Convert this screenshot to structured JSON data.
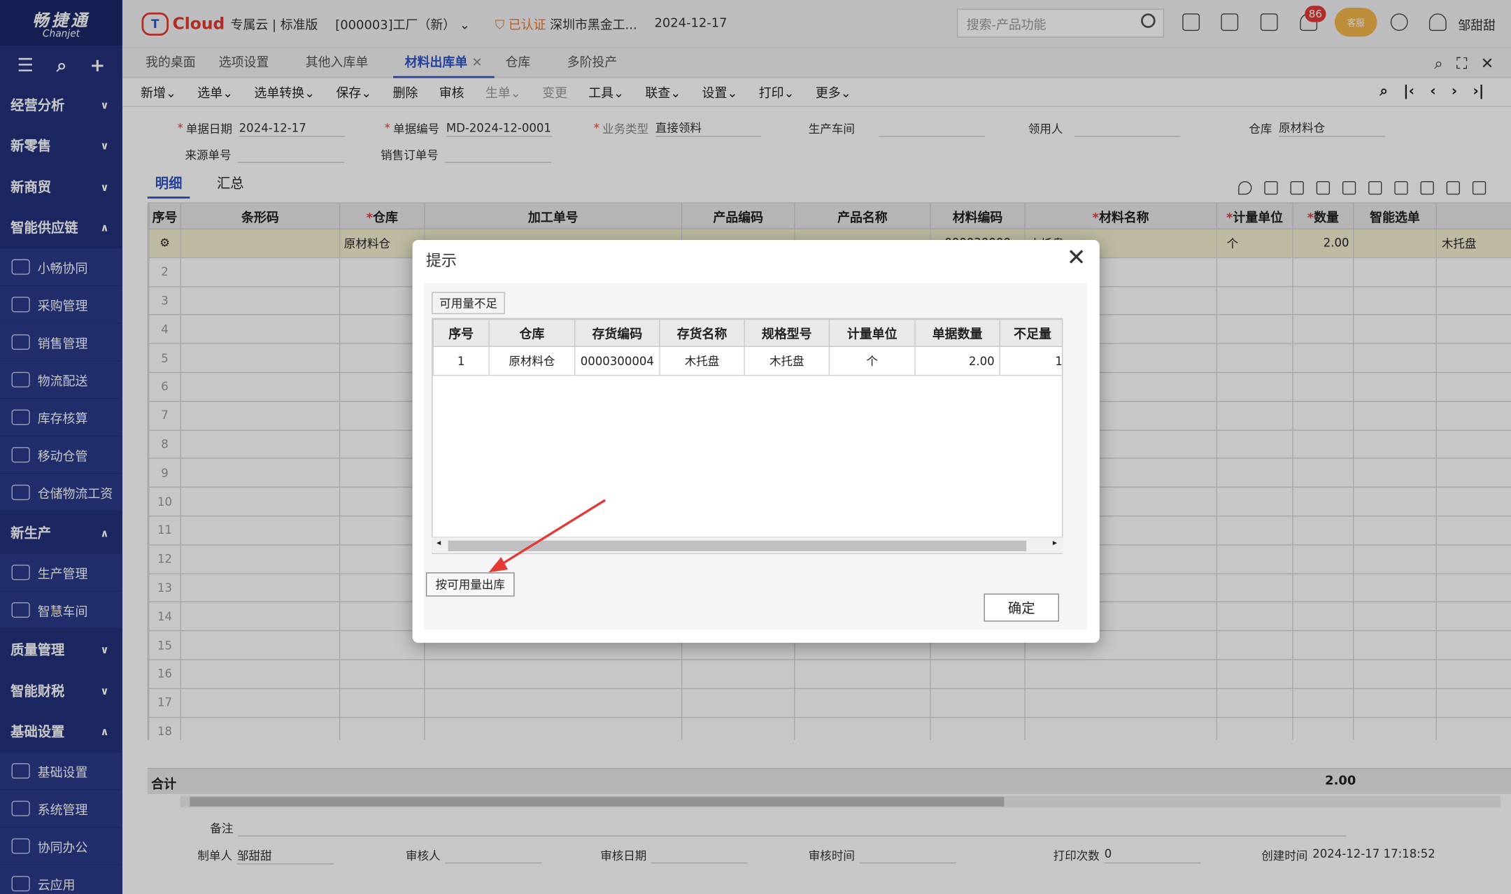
{
  "sidebar": {
    "logo_cn": "畅捷通",
    "logo_en": "Chanjet",
    "groups": [
      {
        "label": "经营分析",
        "arrow": "∨"
      },
      {
        "label": "新零售",
        "arrow": "∨"
      },
      {
        "label": "新商贸",
        "arrow": "∨"
      },
      {
        "label": "智能供应链",
        "arrow": "∧"
      },
      {
        "label": "新生产",
        "arrow": "∧"
      },
      {
        "label": "质量管理",
        "arrow": "∨"
      },
      {
        "label": "智能财税",
        "arrow": "∨"
      },
      {
        "label": "基础设置",
        "arrow": "∧"
      }
    ],
    "items": [
      {
        "label": "小畅协同",
        "icon": "collab-icon"
      },
      {
        "label": "采购管理",
        "icon": "purchase-icon"
      },
      {
        "label": "销售管理",
        "icon": "sales-icon"
      },
      {
        "label": "物流配送",
        "icon": "delivery-icon"
      },
      {
        "label": "库存核算",
        "icon": "inventory-icon"
      },
      {
        "label": "移动仓管",
        "icon": "mobile-warehouse-icon"
      },
      {
        "label": "仓储物流工资",
        "icon": "wage-icon"
      },
      {
        "label": "生产管理",
        "icon": "production-icon"
      },
      {
        "label": "智慧车间",
        "icon": "workshop-icon"
      },
      {
        "label": "基础设置",
        "icon": "settings-icon"
      },
      {
        "label": "系统管理",
        "icon": "system-icon"
      },
      {
        "label": "协同办公",
        "icon": "office-icon"
      },
      {
        "label": "云应用",
        "icon": "cloud-app-icon"
      }
    ]
  },
  "topbar": {
    "product": "Cloud",
    "edition": "专属云 | 标准版",
    "factory": "[000003]工厂（新）",
    "certified": "已认证",
    "company": "深圳市黑金工...",
    "date": "2024-12-17",
    "search_placeholder": "搜索-产品功能",
    "badge_count": "86",
    "kefu": "客服",
    "user": "邹甜甜"
  },
  "tabs": [
    "我的桌面",
    "选项设置",
    "其他入库单",
    "材料出库单",
    "仓库",
    "多阶投产"
  ],
  "active_tab_close": "✕",
  "toolbar": [
    "新增",
    "选单",
    "选单转换",
    "保存",
    "删除",
    "审核",
    "生单",
    "变更",
    "工具",
    "联查",
    "设置",
    "打印",
    "更多"
  ],
  "header": {
    "doc_date_label": "单据日期",
    "doc_date": "2024-12-17",
    "doc_no_label": "单据编号",
    "doc_no": "MD-2024-12-0001",
    "biz_type_label": "业务类型",
    "biz_type": "直接领料",
    "workshop_label": "生产车间",
    "receiver_label": "领用人",
    "warehouse_label": "仓库",
    "warehouse": "原材料仓",
    "source_label": "来源单号",
    "sales_order_label": "销售订单号"
  },
  "subtabs": [
    "明细",
    "汇总"
  ],
  "grid": {
    "headers": [
      "序号",
      "条形码",
      "仓库",
      "加工单号",
      "产品编码",
      "产品名称",
      "材料编码",
      "材料名称",
      "计量单位",
      "数量",
      "智能选单"
    ],
    "required": [
      false,
      false,
      true,
      false,
      false,
      false,
      false,
      true,
      true,
      true,
      false
    ],
    "row1": {
      "warehouse": "原材料仓",
      "material_code": "000030000",
      "material_name": "木托盘",
      "unit": "个",
      "qty": "2.00",
      "extra": "木托盘"
    },
    "row_numbers": [
      "2",
      "3",
      "4",
      "5",
      "6",
      "7",
      "8",
      "9",
      "10",
      "11",
      "12",
      "13",
      "14",
      "15",
      "16",
      "17",
      "18"
    ]
  },
  "summary": {
    "label": "合计",
    "qty": "2.00"
  },
  "footer": {
    "remark_label": "备注",
    "creator_label": "制单人",
    "creator": "邹甜甜",
    "auditor_label": "审核人",
    "audit_date_label": "审核日期",
    "audit_time_label": "审核时间",
    "print_count_label": "打印次数",
    "print_count": "0",
    "create_time_label": "创建时间",
    "create_time": "2024-12-17 17:18:52"
  },
  "dialog": {
    "title": "提示",
    "tab": "可用量不足",
    "headers": [
      "序号",
      "仓库",
      "存货编码",
      "存货名称",
      "规格型号",
      "计量单位",
      "单据数量",
      "不足量"
    ],
    "row": [
      "1",
      "原材料仓",
      "0000300004",
      "木托盘",
      "木托盘",
      "个",
      "2.00",
      "1."
    ],
    "btn_available": "按可用量出库",
    "btn_ok": "确定"
  }
}
